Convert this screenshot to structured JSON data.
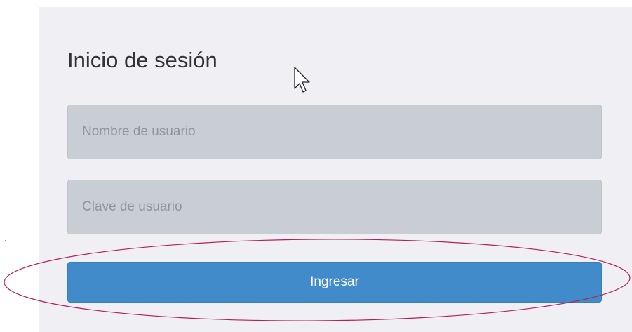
{
  "login": {
    "title": "Inicio de sesión",
    "username": {
      "value": "",
      "placeholder": "Nombre de usuario"
    },
    "password": {
      "value": "",
      "placeholder": "Clave de usuario"
    },
    "submit_label": "Ingresar"
  },
  "colors": {
    "panel_background": "#f0eff4",
    "input_background": "#c9ced4",
    "primary_button": "#428bca",
    "highlight_ellipse": "#b4215a"
  },
  "icons": {
    "cursor": "mouse-pointer-arrow",
    "highlight": "annotation-ellipse"
  }
}
